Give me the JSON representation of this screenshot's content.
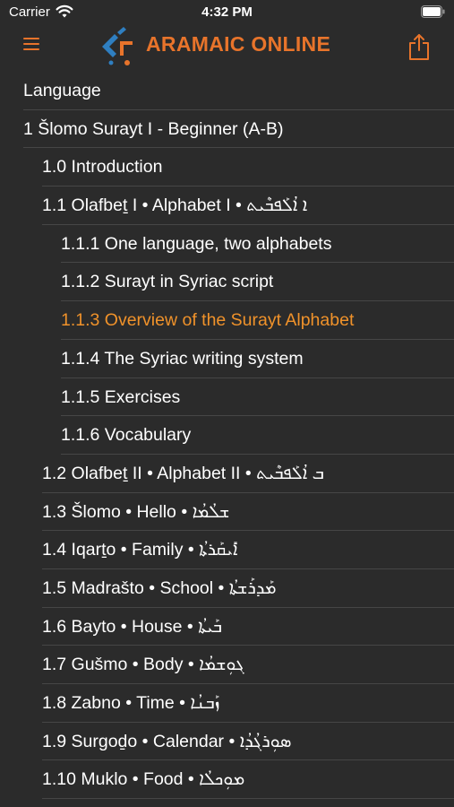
{
  "status_bar": {
    "carrier": "Carrier",
    "time": "4:32 PM"
  },
  "header": {
    "title": "ARAMAIC ONLINE",
    "accent_color": "#e8742b",
    "menu_icon": "hamburger-menu-icon",
    "share_icon": "share-icon"
  },
  "toc": [
    {
      "label": "Language",
      "level": 0
    },
    {
      "label": "1 Šlomo Surayt I - Beginner (A-B)",
      "level": 0
    },
    {
      "label": "1.0 Introduction",
      "level": 1
    },
    {
      "label": "1.1 Olafbeṯ I • Alphabet I • ܐ ܐܳܠܰܦܒܶܝܬ",
      "level": 1
    },
    {
      "label": "1.1.1 One language, two alphabets",
      "level": 2
    },
    {
      "label": "1.1.2 Surayt in Syriac script",
      "level": 2
    },
    {
      "label": "1.1.3 Overview of the Surayt Alphabet",
      "level": 2,
      "active": true
    },
    {
      "label": "1.1.4 The Syriac writing system",
      "level": 2
    },
    {
      "label": "1.1.5 Exercises",
      "level": 2
    },
    {
      "label": "1.1.6 Vocabulary",
      "level": 2
    },
    {
      "label": "1.2 Olafbeṯ II • Alphabet II • ܒ ܐܳܠܰܦܒܶܝܬ",
      "level": 1
    },
    {
      "label": "1.3 Šlomo • Hello • ܫܠܳܡܳܐ",
      "level": 1
    },
    {
      "label": "1.4 Iqarṯo • Family • ܐܺܝܩܰܪܬܳܐ",
      "level": 1
    },
    {
      "label": "1.5 Madrašto • School • ܡܰܕܪܰܫܬܳܐ",
      "level": 1
    },
    {
      "label": "1.6 Bayto • House • ܒܰܝܬܳܐ",
      "level": 1
    },
    {
      "label": "1.7 Gušmo • Body • ܓܘܼܫܡܳܐ",
      "level": 1
    },
    {
      "label": "1.8 Zabno • Time • ܙܰܒܢܳܐ",
      "level": 1
    },
    {
      "label": "1.9 Surgoḏo • Calendar • ܣܘܼܪܓܳܕܳܐ",
      "level": 1
    },
    {
      "label": "1.10 Muklo • Food • ܡܘܼܟܠܳܐ",
      "level": 1
    }
  ]
}
